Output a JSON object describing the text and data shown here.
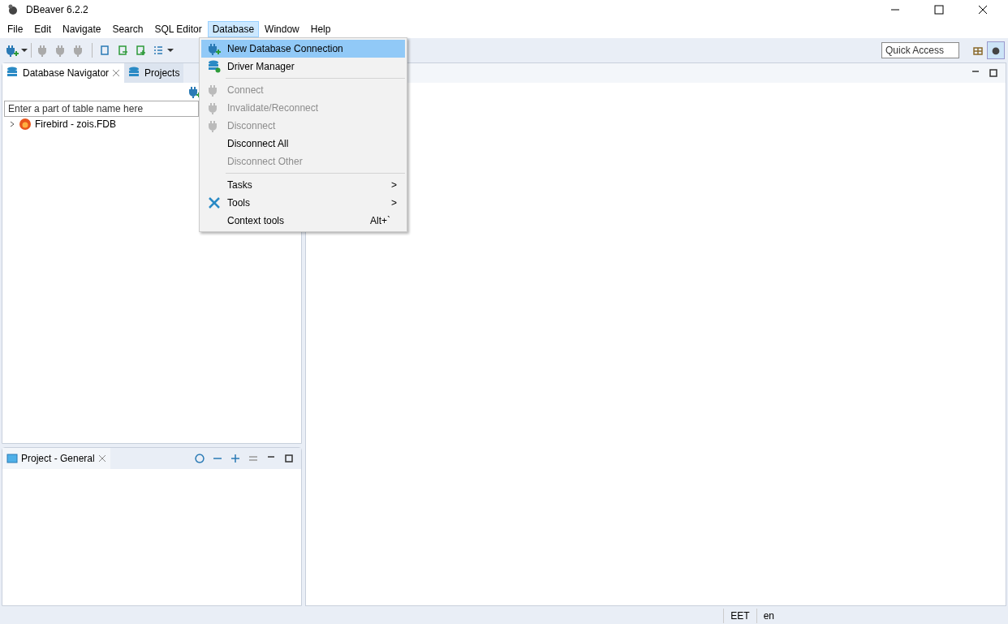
{
  "window": {
    "title": "DBeaver 6.2.2"
  },
  "menu_bar": [
    {
      "label": "File",
      "selected": false
    },
    {
      "label": "Edit",
      "selected": false
    },
    {
      "label": "Navigate",
      "selected": false
    },
    {
      "label": "Search",
      "selected": false
    },
    {
      "label": "SQL Editor",
      "selected": false
    },
    {
      "label": "Database",
      "selected": true
    },
    {
      "label": "Window",
      "selected": false
    },
    {
      "label": "Help",
      "selected": false
    }
  ],
  "database_menu": [
    {
      "label": "New Database Connection",
      "disabled": false,
      "selected": true,
      "separator_after": false
    },
    {
      "label": "Driver Manager",
      "disabled": false,
      "selected": false,
      "separator_after": true
    },
    {
      "label": "Connect",
      "disabled": true,
      "selected": false,
      "separator_after": false
    },
    {
      "label": "Invalidate/Reconnect",
      "disabled": true,
      "selected": false,
      "separator_after": false
    },
    {
      "label": "Disconnect",
      "disabled": true,
      "selected": false,
      "separator_after": false
    },
    {
      "label": "Disconnect All",
      "disabled": false,
      "selected": false,
      "separator_after": false
    },
    {
      "label": "Disconnect Other",
      "disabled": true,
      "selected": false,
      "separator_after": true
    },
    {
      "label": "Tasks",
      "disabled": false,
      "selected": false,
      "separator_after": false,
      "submenu": ">"
    },
    {
      "label": "Tools",
      "disabled": false,
      "selected": false,
      "separator_after": false,
      "submenu": ">"
    },
    {
      "label": "Context tools",
      "disabled": false,
      "selected": false,
      "separator_after": false,
      "shortcut": "Alt+`"
    }
  ],
  "quick_access": {
    "placeholder": "Quick Access"
  },
  "navigator_tabs": [
    {
      "label": "Database Navigator",
      "selected": true
    },
    {
      "label": "Projects",
      "selected": false
    }
  ],
  "filter": {
    "placeholder": "Enter a part of table name here"
  },
  "tree": [
    {
      "label": "Firebird - zois.FDB",
      "expanded": false
    }
  ],
  "project_panel": {
    "title": "Project - General"
  },
  "status_bar": [
    "EET",
    "en"
  ]
}
